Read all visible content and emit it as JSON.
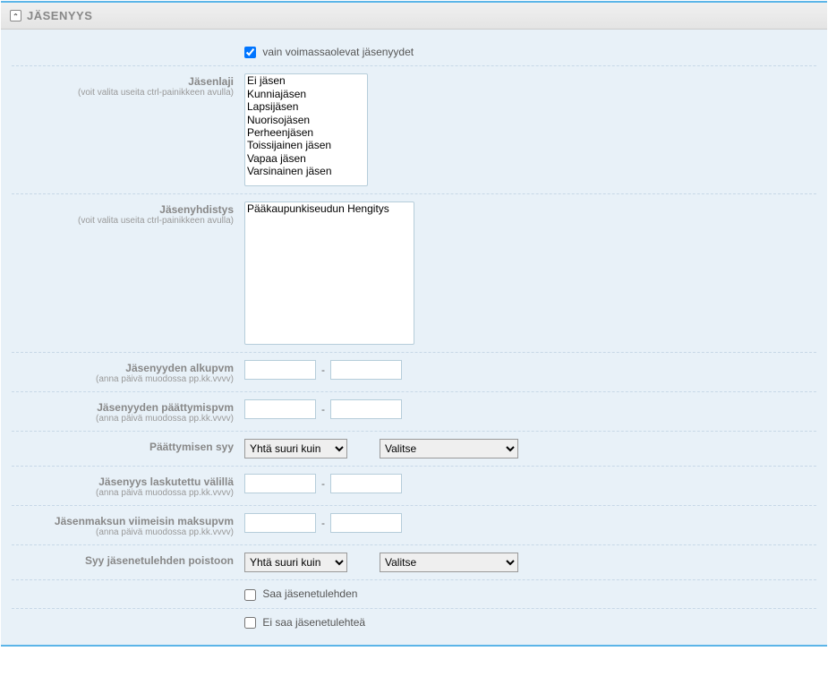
{
  "panel": {
    "title": "JÄSENYYS"
  },
  "checkboxes": {
    "valid_only": "vain voimassaolevat jäsenyydet",
    "saa": "Saa jäsenetulehden",
    "ei_saa": "Ei saa jäsenetulehteä"
  },
  "labels": {
    "jasenlaji": "Jäsenlaji",
    "jasenlaji_sub": "(voit valita useita ctrl-painikkeen avulla)",
    "jasenyhdistys": "Jäsenyhdistys",
    "jasenyhdistys_sub": "(voit valita useita ctrl-painikkeen avulla)",
    "alkupvm": "Jäsenyyden alkupvm",
    "alkupvm_sub": "(anna päivä muodossa pp.kk.vvvv)",
    "paattymispvm": "Jäsenyyden päättymispvm",
    "paattymispvm_sub": "(anna päivä muodossa pp.kk.vvvv)",
    "paattymisen_syy": "Päättymisen syy",
    "laskutettu": "Jäsenyys laskutettu välillä",
    "laskutettu_sub": "(anna päivä muodossa pp.kk.vvvv)",
    "maksupvm": "Jäsenmaksun viimeisin maksupvm",
    "maksupvm_sub": "(anna päivä muodossa pp.kk.vvvv)",
    "poisto_syy": "Syy jäsenetulehden poistoon"
  },
  "lists": {
    "jasenlaji": [
      "Ei jäsen",
      "Kunniajäsen",
      "Lapsijäsen",
      "Nuorisojäsen",
      "Perheenjäsen",
      "Toissijainen jäsen",
      "Vapaa jäsen",
      "Varsinainen jäsen"
    ],
    "jasenyhdistys": [
      "Pääkaupunkiseudun Hengitys"
    ]
  },
  "dropdowns": {
    "operator": "Yhtä suuri kuin",
    "valitse": "Valitse"
  },
  "dash": "-"
}
